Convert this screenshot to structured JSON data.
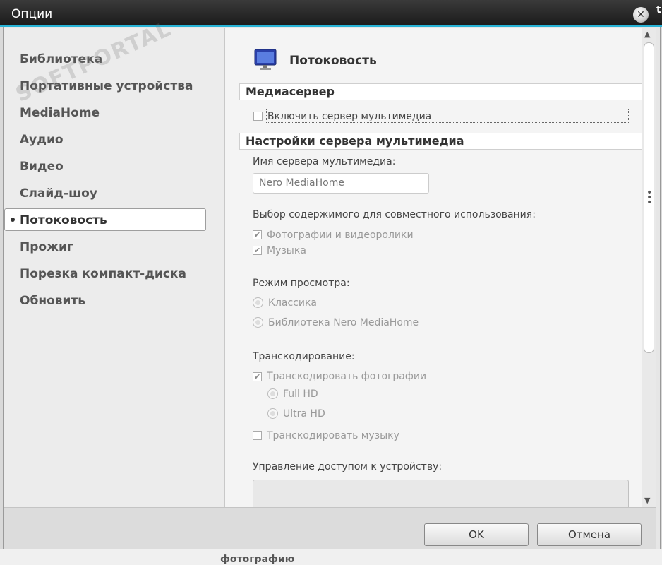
{
  "window": {
    "title": "Опции",
    "close_label": "✕",
    "corner_text": "t"
  },
  "sidebar": {
    "items": [
      {
        "label": "Библиотека"
      },
      {
        "label": "Портативные устройства"
      },
      {
        "label": "MediaHome"
      },
      {
        "label": "Аудио"
      },
      {
        "label": "Видео"
      },
      {
        "label": "Слайд-шоу"
      },
      {
        "label": "Потоковость"
      },
      {
        "label": "Прожиг"
      },
      {
        "label": "Порезка компакт-диска"
      },
      {
        "label": "Обновить"
      }
    ],
    "selected_index": 6
  },
  "content": {
    "title": "Потоковость",
    "section_media_server": "Медиасервер",
    "enable_server": {
      "label": "Включить сервер мультимедиа",
      "checked": false
    },
    "section_server_settings": "Настройки сервера мультимедиа",
    "server_name_label": "Имя сервера мультимедиа:",
    "server_name_placeholder": "Nero MediaHome",
    "share_label": "Выбор содержимого для совместного использования:",
    "share_photos": {
      "label": "Фотографии и видеоролики",
      "checked": true
    },
    "share_music": {
      "label": "Музыка",
      "checked": true
    },
    "view_mode_label": "Режим просмотра:",
    "view_classic": "Классика",
    "view_library": "Библиотека Nero MediaHome",
    "transcode_label": "Транскодирование:",
    "transcode_photos": {
      "label": "Транскодировать фотографии",
      "checked": true
    },
    "full_hd": "Full HD",
    "ultra_hd": "Ultra HD",
    "transcode_music": {
      "label": "Транскодировать музыку",
      "checked": false
    },
    "access_label": "Управление доступом к устройству:"
  },
  "footer": {
    "ok_label": "OK",
    "cancel_label": "Отмена"
  },
  "background": {
    "bottom_text": "фотографию"
  },
  "watermark": "SOFTPORTAL"
}
